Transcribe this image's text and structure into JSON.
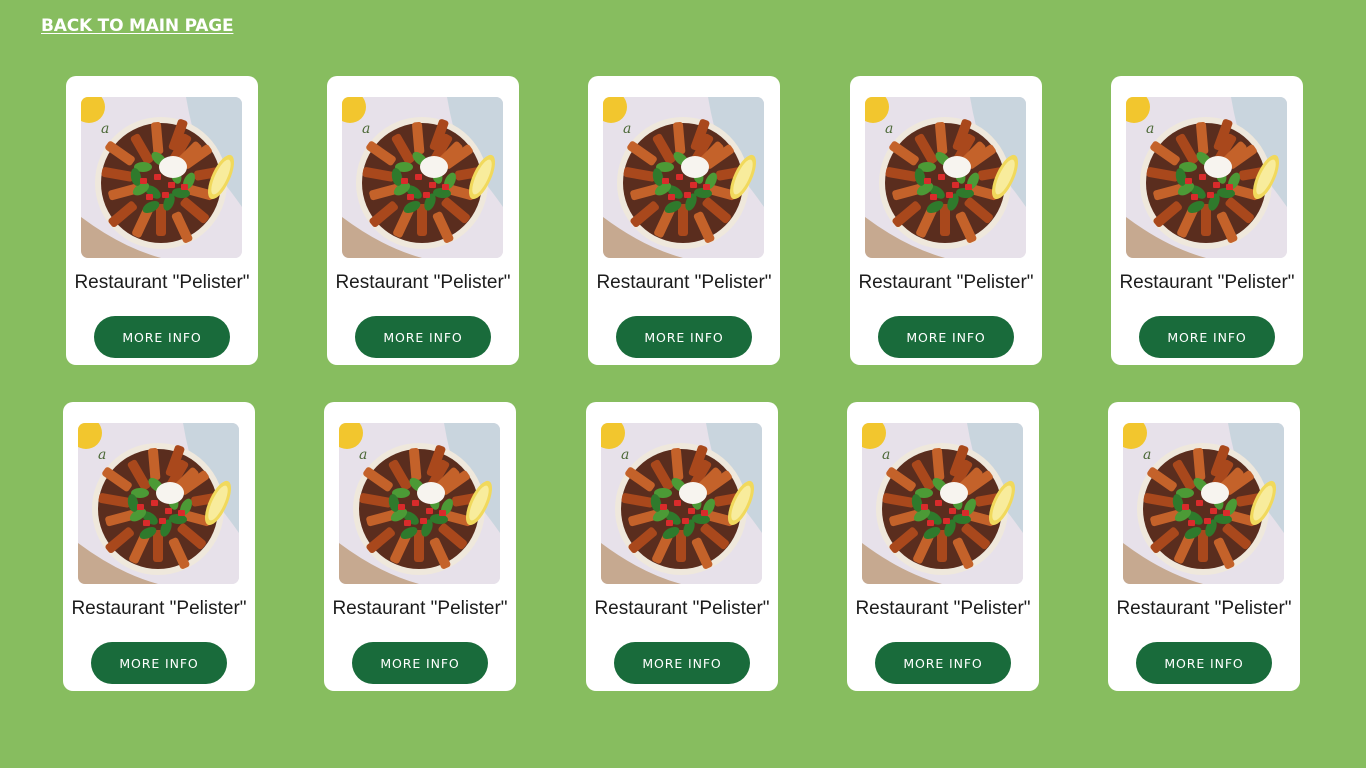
{
  "nav": {
    "back_label": "BACK TO MAIN PAGE"
  },
  "colors": {
    "background": "#87bd5f",
    "card": "#ffffff",
    "button": "#196b3b",
    "button_text": "#ffffff"
  },
  "cards": [
    {
      "title": "Restaurant \"Pelister\"",
      "button_label": "MORE INFO",
      "image": "food-bowl-image"
    },
    {
      "title": "Restaurant \"Pelister\"",
      "button_label": "MORE INFO",
      "image": "food-bowl-image"
    },
    {
      "title": "Restaurant \"Pelister\"",
      "button_label": "MORE INFO",
      "image": "food-bowl-image"
    },
    {
      "title": "Restaurant \"Pelister\"",
      "button_label": "MORE INFO",
      "image": "food-bowl-image"
    },
    {
      "title": "Restaurant \"Pelister\"",
      "button_label": "MORE INFO",
      "image": "food-bowl-image"
    },
    {
      "title": "Restaurant \"Pelister\"",
      "button_label": "MORE INFO",
      "image": "food-bowl-image"
    },
    {
      "title": "Restaurant \"Pelister\"",
      "button_label": "MORE INFO",
      "image": "food-bowl-image"
    },
    {
      "title": "Restaurant \"Pelister\"",
      "button_label": "MORE INFO",
      "image": "food-bowl-image"
    },
    {
      "title": "Restaurant \"Pelister\"",
      "button_label": "MORE INFO",
      "image": "food-bowl-image"
    },
    {
      "title": "Restaurant \"Pelister\"",
      "button_label": "MORE INFO",
      "image": "food-bowl-image"
    }
  ]
}
